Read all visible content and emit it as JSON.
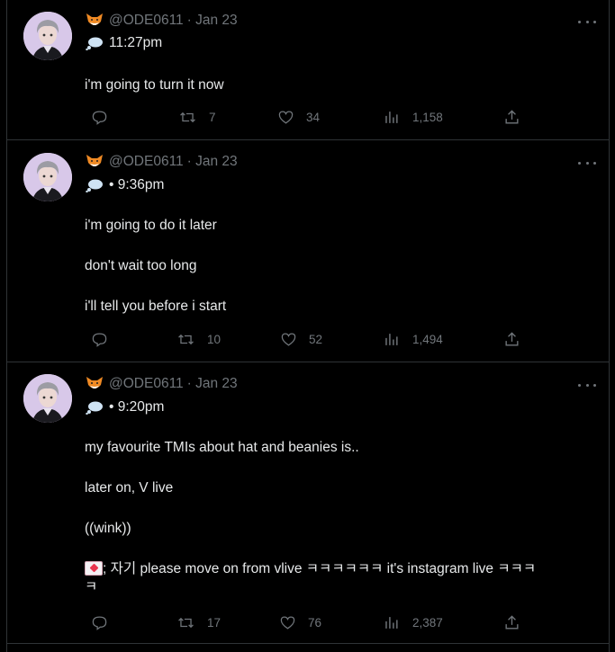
{
  "colors": {
    "background": "#000000",
    "text": "#e7e9ea",
    "muted": "#71767b",
    "divider": "#2f3336"
  },
  "tweets": [
    {
      "handle": "@ODE0611",
      "date": "· Jan 23",
      "time_line": "11:27pm",
      "body": [
        "i'm going to turn it now"
      ],
      "stats": {
        "retweets": "7",
        "likes": "34",
        "views": "1,158"
      }
    },
    {
      "handle": "@ODE0611",
      "date": "· Jan 23",
      "time_line": "• 9:36pm",
      "body": [
        "i'm going to do it later",
        "don't wait too long",
        "i'll tell you before i start"
      ],
      "stats": {
        "retweets": "10",
        "likes": "52",
        "views": "1,494"
      }
    },
    {
      "handle": "@ODE0611",
      "date": "· Jan 23",
      "time_line": "• 9:20pm",
      "body": [
        "my favourite TMIs about hat and beanies is..",
        "later on, V live",
        "((wink))"
      ],
      "last_line_a": "; 자기 please move on from vlive ㅋㅋㅋㅋㅋㅋ it's instagram live ㅋㅋㅋ",
      "last_line_b": "ㅋ",
      "stats": {
        "retweets": "17",
        "likes": "76",
        "views": "2,387"
      }
    }
  ],
  "icons": {
    "handle_emoji": "fox-face-icon",
    "time_emoji": "thought-bubble-icon",
    "message_emoji": "love-letter-icon",
    "actions": [
      "reply-icon",
      "retweet-icon",
      "like-icon",
      "views-icon",
      "share-icon"
    ]
  }
}
